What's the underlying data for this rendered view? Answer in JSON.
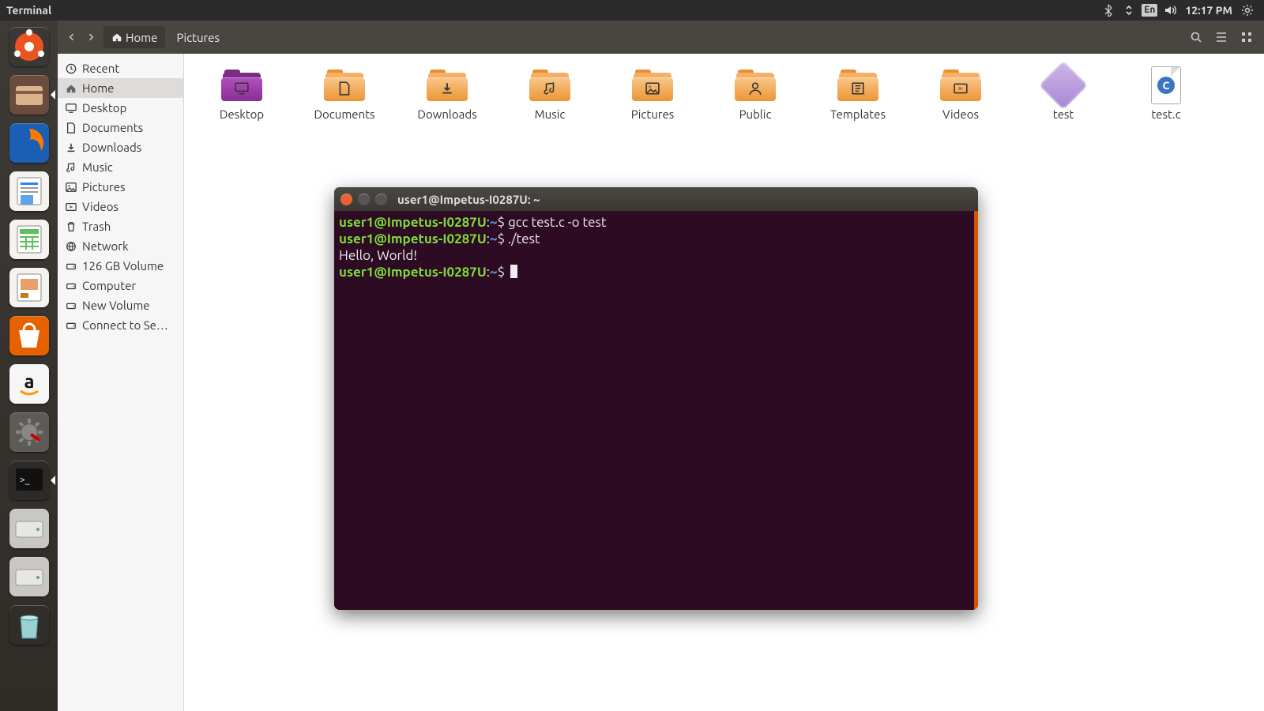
{
  "top_panel": {
    "app": "Terminal",
    "lang": "En",
    "clock": "12:17 PM"
  },
  "nautilus": {
    "path": [
      {
        "label": "Home",
        "home": true
      },
      {
        "label": "Pictures",
        "home": false
      }
    ],
    "sidebar": [
      {
        "icon": "clock",
        "label": "Recent"
      },
      {
        "icon": "home",
        "label": "Home",
        "selected": true
      },
      {
        "icon": "desktop",
        "label": "Desktop"
      },
      {
        "icon": "doc",
        "label": "Documents"
      },
      {
        "icon": "down",
        "label": "Downloads"
      },
      {
        "icon": "music",
        "label": "Music"
      },
      {
        "icon": "pic",
        "label": "Pictures"
      },
      {
        "icon": "video",
        "label": "Videos"
      },
      {
        "icon": "trash",
        "label": "Trash"
      },
      {
        "icon": "net",
        "label": "Network"
      },
      {
        "icon": "disk",
        "label": "126 GB Volume"
      },
      {
        "icon": "disk",
        "label": "Computer"
      },
      {
        "icon": "disk",
        "label": "New Volume"
      },
      {
        "icon": "disk",
        "label": "Connect to Se…"
      }
    ],
    "items": [
      {
        "type": "folder-purple",
        "glyph": "desktop",
        "label": "Desktop"
      },
      {
        "type": "folder",
        "glyph": "doc",
        "label": "Documents"
      },
      {
        "type": "folder",
        "glyph": "down",
        "label": "Downloads"
      },
      {
        "type": "folder",
        "glyph": "music",
        "label": "Music"
      },
      {
        "type": "folder",
        "glyph": "pic",
        "label": "Pictures"
      },
      {
        "type": "folder",
        "glyph": "public",
        "label": "Public"
      },
      {
        "type": "folder",
        "glyph": "tmpl",
        "label": "Templates"
      },
      {
        "type": "folder",
        "glyph": "video",
        "label": "Videos"
      },
      {
        "type": "diamond",
        "label": "test"
      },
      {
        "type": "cfile",
        "label": "test.c"
      }
    ]
  },
  "terminal": {
    "title": "user1@Impetus-I0287U: ~",
    "lines": [
      {
        "user": "user1@Impetus-I0287U",
        "path": "~",
        "cmd": "gcc test.c -o test"
      },
      {
        "user": "user1@Impetus-I0287U",
        "path": "~",
        "cmd": "./test"
      },
      {
        "plain": "Hello, World!"
      },
      {
        "user": "user1@Impetus-I0287U",
        "path": "~",
        "cmd": "",
        "cursor": true
      }
    ]
  },
  "launcher": [
    {
      "name": "dash",
      "bg": "#3a3734"
    },
    {
      "name": "files",
      "bg": "#6b4b3d",
      "active": true
    },
    {
      "name": "firefox",
      "bg": "#1a5fb4"
    },
    {
      "name": "writer",
      "bg": "#f5f3f0"
    },
    {
      "name": "calc",
      "bg": "#f5f3f0"
    },
    {
      "name": "impress",
      "bg": "#f5f3f0"
    },
    {
      "name": "software",
      "bg": "#e66100"
    },
    {
      "name": "amazon",
      "bg": "#f6f6f6"
    },
    {
      "name": "settings",
      "bg": "#5e5a56"
    },
    {
      "name": "terminal",
      "bg": "#2d2a27",
      "active": true
    },
    {
      "name": "drive1",
      "bg": "#c9c7c4"
    },
    {
      "name": "drive2",
      "bg": "#c9c7c4"
    },
    {
      "name": "trash",
      "bg": "transparent"
    }
  ]
}
